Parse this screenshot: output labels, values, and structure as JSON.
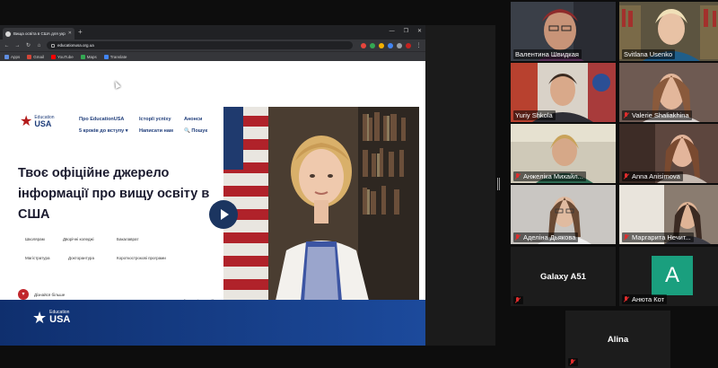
{
  "browser": {
    "tab_title": "Вища освіта в США для україн...",
    "tab_close": "✕",
    "new_tab": "+",
    "window_controls": [
      "—",
      "❐",
      "✕"
    ],
    "url": "educationusa.org.ua",
    "nav_back": "←",
    "nav_forward": "→",
    "reload": "↻",
    "home": "⌂",
    "menu": "⋮",
    "bookmarks": [
      {
        "label": "Apps",
        "color": "#5f8de0"
      },
      {
        "label": "Gmail",
        "color": "#d44638"
      },
      {
        "label": "YouTube",
        "color": "#ff0000"
      },
      {
        "label": "Maps",
        "color": "#34a853"
      },
      {
        "label": "Translate",
        "color": "#4285f4"
      }
    ]
  },
  "site": {
    "logo_top": "Education",
    "logo_bottom": "USA",
    "nav": [
      "Про EducationUSA",
      "Історії успіху",
      "Анонси",
      "5 кроків до вступу ▾",
      "Написати нам",
      "🔍 Пошук"
    ],
    "hero_title": "Твоє офіційне джерело інформації про вищу освіту в США",
    "pills": [
      "Школярам",
      "Дворічні коледжі",
      "Бакалаврат",
      "Магістратура",
      "Докторантура",
      "Короткострокові програми"
    ],
    "more_label": "Дізнайся більше",
    "more_icon": "▾",
    "socials": [
      "f",
      "◎",
      "✆",
      "▶",
      "◉"
    ],
    "footer_logo_top": "Education",
    "footer_logo_bottom": "USA"
  },
  "participants": [
    {
      "name": "Валентина Швидкая"
    },
    {
      "name": "Svitlana Usenko"
    },
    {
      "name": "Yuriy Shkola"
    },
    {
      "name": "Valerie Shaliakhina"
    },
    {
      "name": "Анжеліка Михайл..."
    },
    {
      "name": "Anna Anisimova"
    },
    {
      "name": "Аделіна Дьякова"
    },
    {
      "name": "Маргарита Нечит..."
    },
    {
      "name": "Galaxy A51"
    },
    {
      "name": "Анюта Кот",
      "avatar_letter": "A",
      "avatar_color": "#1a9f7e"
    },
    {
      "name": "Alina"
    }
  ],
  "colors": {
    "active_speaker_outline": "#c8d94a",
    "muted_icon": "#e02c2c",
    "brand_blue": "#1f3d7a",
    "brand_red": "#b31b1b"
  }
}
